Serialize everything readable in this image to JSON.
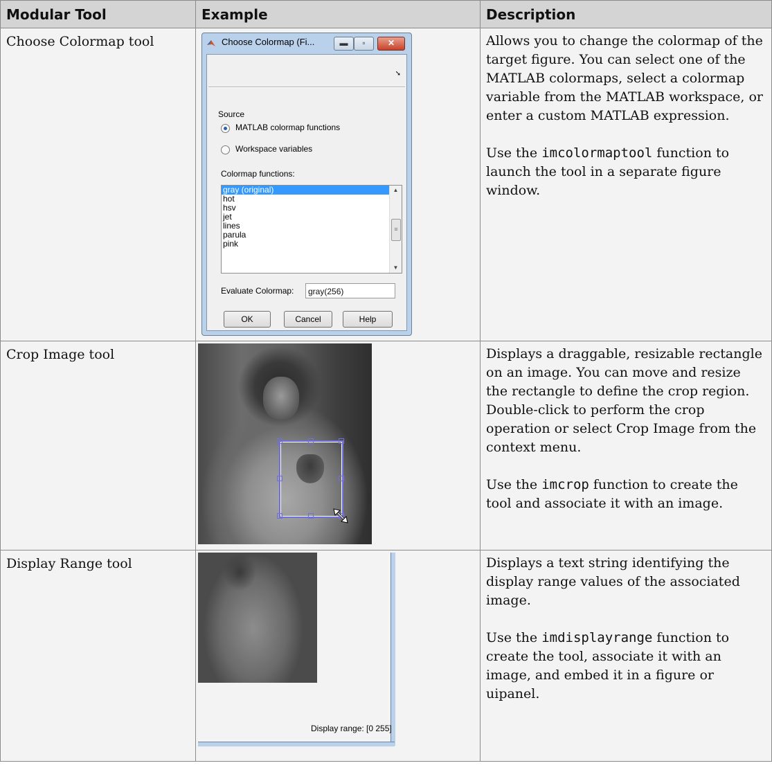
{
  "headers": {
    "tool": "Modular Tool",
    "example": "Example",
    "description": "Description"
  },
  "rows": [
    {
      "tool": "Choose Colormap tool",
      "description_p1": "Allows you to change the colormap of the target figure. You can select one of the MATLAB colormaps, select a colormap variable from the MATLAB workspace, or enter a custom MATLAB expression.",
      "desc_use": "Use the ",
      "desc_code": "imcolormaptool",
      "desc_rest": " function to launch the tool in a separate figure window."
    },
    {
      "tool": "Crop Image tool",
      "description_p1": "Displays a draggable, resizable rectangle on an image. You can move and resize the rectangle to define the crop region. Double-click to perform the crop operation or select Crop Image from the context menu.",
      "desc_use": "Use the ",
      "desc_code": "imcrop",
      "desc_rest": " function to create the tool and associate it with an image."
    },
    {
      "tool": "Display Range tool",
      "description_p1": "Displays a text string identifying the display range values of the associated image.",
      "desc_use": "Use the ",
      "desc_code": "imdisplayrange",
      "desc_rest": " function to create the tool, associate it with an image, and embed it in a figure or uipanel."
    }
  ],
  "dialog": {
    "title": "Choose Colormap (Fi...",
    "source_label": "Source",
    "radio1": "MATLAB colormap functions",
    "radio2": "Workspace variables",
    "functions_label": "Colormap functions:",
    "list_items": [
      "gray (original)",
      "hot",
      "hsv",
      "jet",
      "lines",
      "parula",
      "pink"
    ],
    "evaluate_label": "Evaluate Colormap:",
    "evaluate_value": "gray(256)",
    "ok": "OK",
    "cancel": "Cancel",
    "help": "Help"
  },
  "display_range_text": "Display range: [0 255]"
}
